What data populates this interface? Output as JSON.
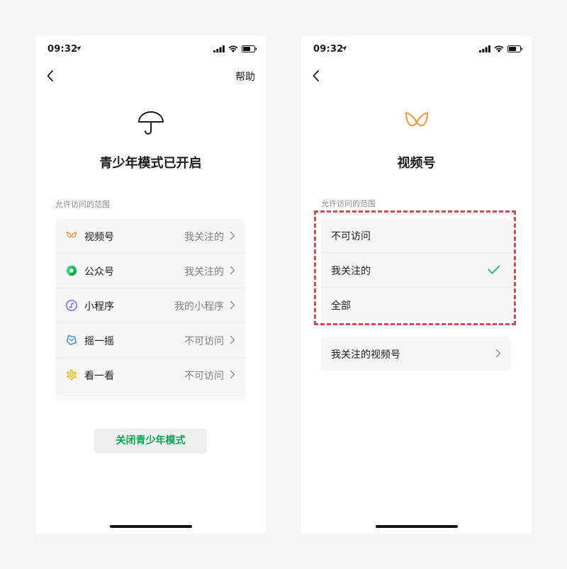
{
  "left_phone": {
    "status": {
      "time": "09:32"
    },
    "help_label": "帮助",
    "title": "青少年模式已开启",
    "section_label": "允许访问的范围",
    "items": [
      {
        "label": "视频号",
        "value": "我关注的",
        "icon": "channels-icon"
      },
      {
        "label": "公众号",
        "value": "我关注的",
        "icon": "official-account-icon"
      },
      {
        "label": "小程序",
        "value": "我的小程序",
        "icon": "mini-program-icon"
      },
      {
        "label": "摇一摇",
        "value": "不可访问",
        "icon": "shake-icon"
      },
      {
        "label": "看一看",
        "value": "不可访问",
        "icon": "top-stories-icon"
      }
    ],
    "close_button": "关闭青少年模式"
  },
  "right_phone": {
    "status": {
      "time": "09:32"
    },
    "title": "视频号",
    "section_label": "允许访问的范围",
    "options": [
      {
        "label": "不可访问",
        "selected": false
      },
      {
        "label": "我关注的",
        "selected": true
      },
      {
        "label": "全部",
        "selected": false
      }
    ],
    "followed_link": "我关注的视频号"
  },
  "colors": {
    "accent_green": "#07a454",
    "channels_orange": "#f2994a",
    "highlight_red": "#d24c4c"
  }
}
